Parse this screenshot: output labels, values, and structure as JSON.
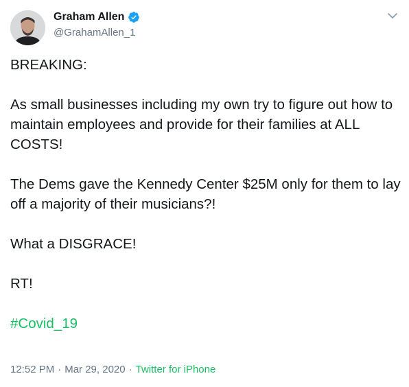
{
  "author": {
    "display_name": "Graham Allen",
    "handle": "@GrahamAllen_1",
    "verified": true,
    "avatar_icon": "user-avatar",
    "verified_icon": "verified-badge-icon"
  },
  "menu": {
    "icon": "chevron-down-icon"
  },
  "tweet": {
    "line_1": "BREAKING:",
    "para_2": "As small businesses including my own try to figure out how to maintain employees and provide for their families at ALL COSTS!",
    "para_3": "The Dems gave the Kennedy Center $25M only for them to lay off a majority of their musicians?!",
    "para_4": "What a DISGRACE!",
    "para_5": "RT!",
    "hashtag": "#Covid_19"
  },
  "meta": {
    "time": "12:52 PM",
    "separator_1": "·",
    "date": "Mar 29, 2020",
    "separator_2": "·",
    "source": "Twitter for iPhone"
  },
  "colors": {
    "text": "#14171a",
    "secondary": "#657786",
    "accent_green": "#17bf63",
    "verified_blue": "#1da1f2"
  }
}
